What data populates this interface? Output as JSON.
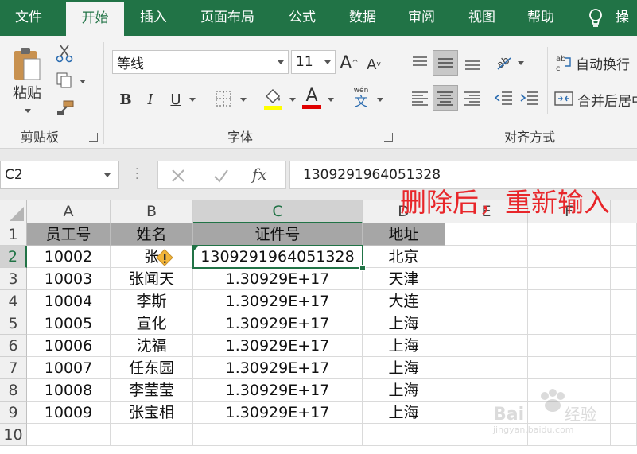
{
  "tabs": [
    {
      "label": "文件"
    },
    {
      "label": "开始",
      "active": true
    },
    {
      "label": "插入"
    },
    {
      "label": "页面布局"
    },
    {
      "label": "公式"
    },
    {
      "label": "数据"
    },
    {
      "label": "审阅"
    },
    {
      "label": "视图"
    },
    {
      "label": "帮助"
    },
    {
      "label": "操"
    }
  ],
  "ribbon": {
    "clipboard": {
      "paste_label": "粘贴",
      "group_label": "剪贴板"
    },
    "font": {
      "font_name": "等线",
      "font_size": "11",
      "group_label": "字体",
      "phonetic_label": "wén",
      "phonetic_char": "文"
    },
    "alignment": {
      "wrap_text_label": "自动换行",
      "merge_label": "合并后居中",
      "group_label": "对齐方式"
    }
  },
  "formula_bar": {
    "name_box": "C2",
    "fx_label": "fx",
    "value": "1309291964051328"
  },
  "annotation": "删除后，重新输入",
  "grid": {
    "columns": [
      "A",
      "B",
      "C",
      "D",
      "E",
      "F"
    ],
    "rows": [
      {
        "num": "1",
        "cells": [
          "员工号",
          "姓名",
          "证件号",
          "地址"
        ]
      },
      {
        "num": "2",
        "cells": [
          "10002",
          "张",
          "1309291964051328",
          "北京"
        ]
      },
      {
        "num": "3",
        "cells": [
          "10003",
          "张闻天",
          "1.30929E+17",
          "天津"
        ]
      },
      {
        "num": "4",
        "cells": [
          "10004",
          "李斯",
          "1.30929E+17",
          "大连"
        ]
      },
      {
        "num": "5",
        "cells": [
          "10005",
          "宣化",
          "1.30929E+17",
          "上海"
        ]
      },
      {
        "num": "6",
        "cells": [
          "10006",
          "沈福",
          "1.30929E+17",
          "上海"
        ]
      },
      {
        "num": "7",
        "cells": [
          "10007",
          "任东园",
          "1.30929E+17",
          "上海"
        ]
      },
      {
        "num": "8",
        "cells": [
          "10008",
          "李莹莹",
          "1.30929E+17",
          "上海"
        ]
      },
      {
        "num": "9",
        "cells": [
          "10009",
          "张宝相",
          "1.30929E+17",
          "上海"
        ]
      },
      {
        "num": "10",
        "cells": [
          "",
          "",
          "",
          ""
        ]
      }
    ]
  },
  "colors": {
    "brand": "#217346",
    "header_fill": "#a6a6a6",
    "annotation": "#e8262a",
    "warning": "#f2b53a"
  }
}
